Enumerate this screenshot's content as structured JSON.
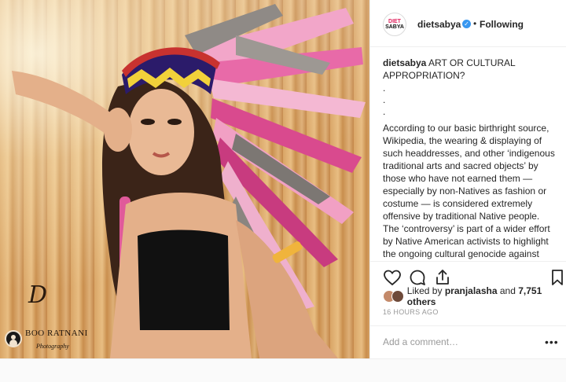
{
  "photo": {
    "watermark_initial": "D",
    "watermark_name": "BOO RATNANI",
    "watermark_sub": "Photography"
  },
  "post": {
    "avatar_text_top": "DIET",
    "avatar_text_bottom": "SABYA",
    "username": "dietsabya",
    "verified_symbol": "✓",
    "separator": "•",
    "follow_state": "Following"
  },
  "caption": {
    "username": "dietsabya",
    "headline": "ART OR CULTURAL APPROPRIATION?",
    "dots": [
      ".",
      ".",
      "."
    ],
    "body": "According to our basic birthright source, Wikipedia, the wearing & displaying of such headdresses, and other ‘indigenous traditional arts and sacred objects’ by those who have not earned them — especially by non-Natives as fashion or costume — is considered extremely offensive by traditional Native people. The ‘controversy’ is part of a wider effort by Native American activists to highlight the ongoing cultural genocide against indigenous peoples (especially in the United States and Canada). The stupid"
  },
  "actions": {
    "like_icon": "heart-icon",
    "comment_icon": "comment-icon",
    "share_icon": "share-icon",
    "save_icon": "bookmark-icon"
  },
  "likes": {
    "prefix": "Liked by ",
    "user": "pranjalasha",
    "middle": " and ",
    "count": "7,751 others"
  },
  "timestamp": "16 HOURS AGO",
  "comment": {
    "placeholder": "Add a comment…",
    "more_symbol": "•••"
  },
  "colors": {
    "verified": "#3897f0",
    "text": "#262626",
    "muted": "#999999",
    "border": "#efefef"
  }
}
